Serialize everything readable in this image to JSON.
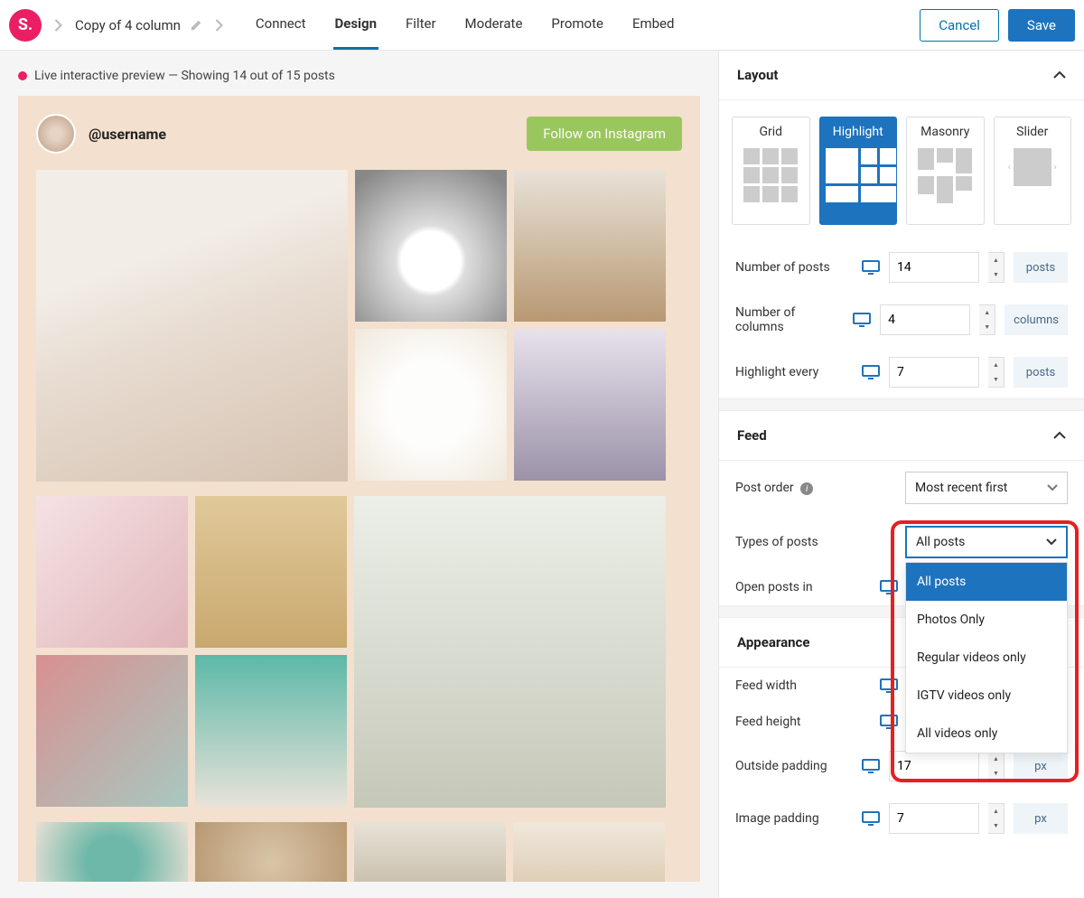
{
  "topbar": {
    "breadcrumb_title": "Copy of 4 column",
    "tabs": [
      "Connect",
      "Design",
      "Filter",
      "Moderate",
      "Promote",
      "Embed"
    ],
    "active_tab": "Design",
    "cancel": "Cancel",
    "save": "Save"
  },
  "preview": {
    "notice": "Live interactive preview — Showing 14 out of 15 posts",
    "username": "@username",
    "follow": "Follow on Instagram"
  },
  "layout": {
    "section_title": "Layout",
    "cards": [
      "Grid",
      "Highlight",
      "Masonry",
      "Slider"
    ],
    "active_card": "Highlight",
    "fields": {
      "num_posts_label": "Number of posts",
      "num_posts_value": "14",
      "num_posts_unit": "posts",
      "num_cols_label": "Number of columns",
      "num_cols_value": "4",
      "num_cols_unit": "columns",
      "highlight_label": "Highlight every",
      "highlight_value": "7",
      "highlight_unit": "posts"
    }
  },
  "feed": {
    "section_title": "Feed",
    "post_order_label": "Post order",
    "post_order_value": "Most recent first",
    "types_label": "Types of posts",
    "types_value": "All posts",
    "types_options": [
      "All posts",
      "Photos Only",
      "Regular videos only",
      "IGTV videos only",
      "All videos only"
    ],
    "open_in_label": "Open posts in"
  },
  "appearance": {
    "section_title": "Appearance",
    "feed_width_label": "Feed width",
    "feed_height_label": "Feed height",
    "outside_pad_label": "Outside padding",
    "outside_pad_value": "17",
    "outside_pad_unit": "px",
    "image_pad_label": "Image padding",
    "image_pad_value": "7",
    "image_pad_unit": "px"
  }
}
